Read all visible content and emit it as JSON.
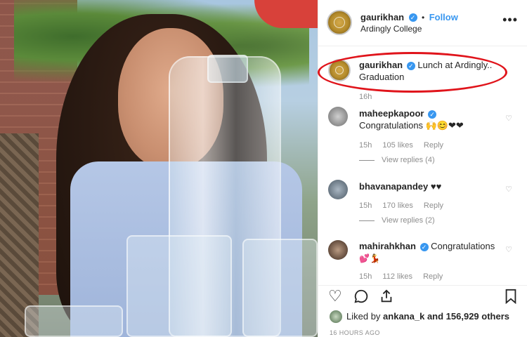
{
  "post": {
    "username": "gaurikhan",
    "follow_label": "Follow",
    "location": "Ardingly College",
    "more_label": "•••"
  },
  "caption": {
    "username": "gaurikhan",
    "text": "Lunch at Ardingly.. Graduation",
    "time": "16h"
  },
  "comments": [
    {
      "username": "maheepkapoor",
      "verified": true,
      "text": "Congratulations 🙌😊❤❤",
      "time": "15h",
      "likes": "105 likes",
      "reply_label": "Reply",
      "view_replies": "View replies (4)"
    },
    {
      "username": "bhavanapandey",
      "verified": false,
      "text": "♥♥",
      "time": "15h",
      "likes": "170 likes",
      "reply_label": "Reply",
      "view_replies": "View replies (2)"
    },
    {
      "username": "mahirahkhan",
      "verified": true,
      "text": "Congratulations",
      "emoji_line": "💕💃",
      "time": "15h",
      "likes": "112 likes",
      "reply_label": "Reply"
    }
  ],
  "actions": {
    "liked_by_prefix": "Liked by",
    "liked_by_user": "ankana_k",
    "liked_by_suffix": "and 156,929 others",
    "timestamp": "16 HOURS AGO"
  },
  "colors": {
    "accent": "#3897f0",
    "highlight_oval": "#e0141b",
    "heart": "#ed4956"
  }
}
